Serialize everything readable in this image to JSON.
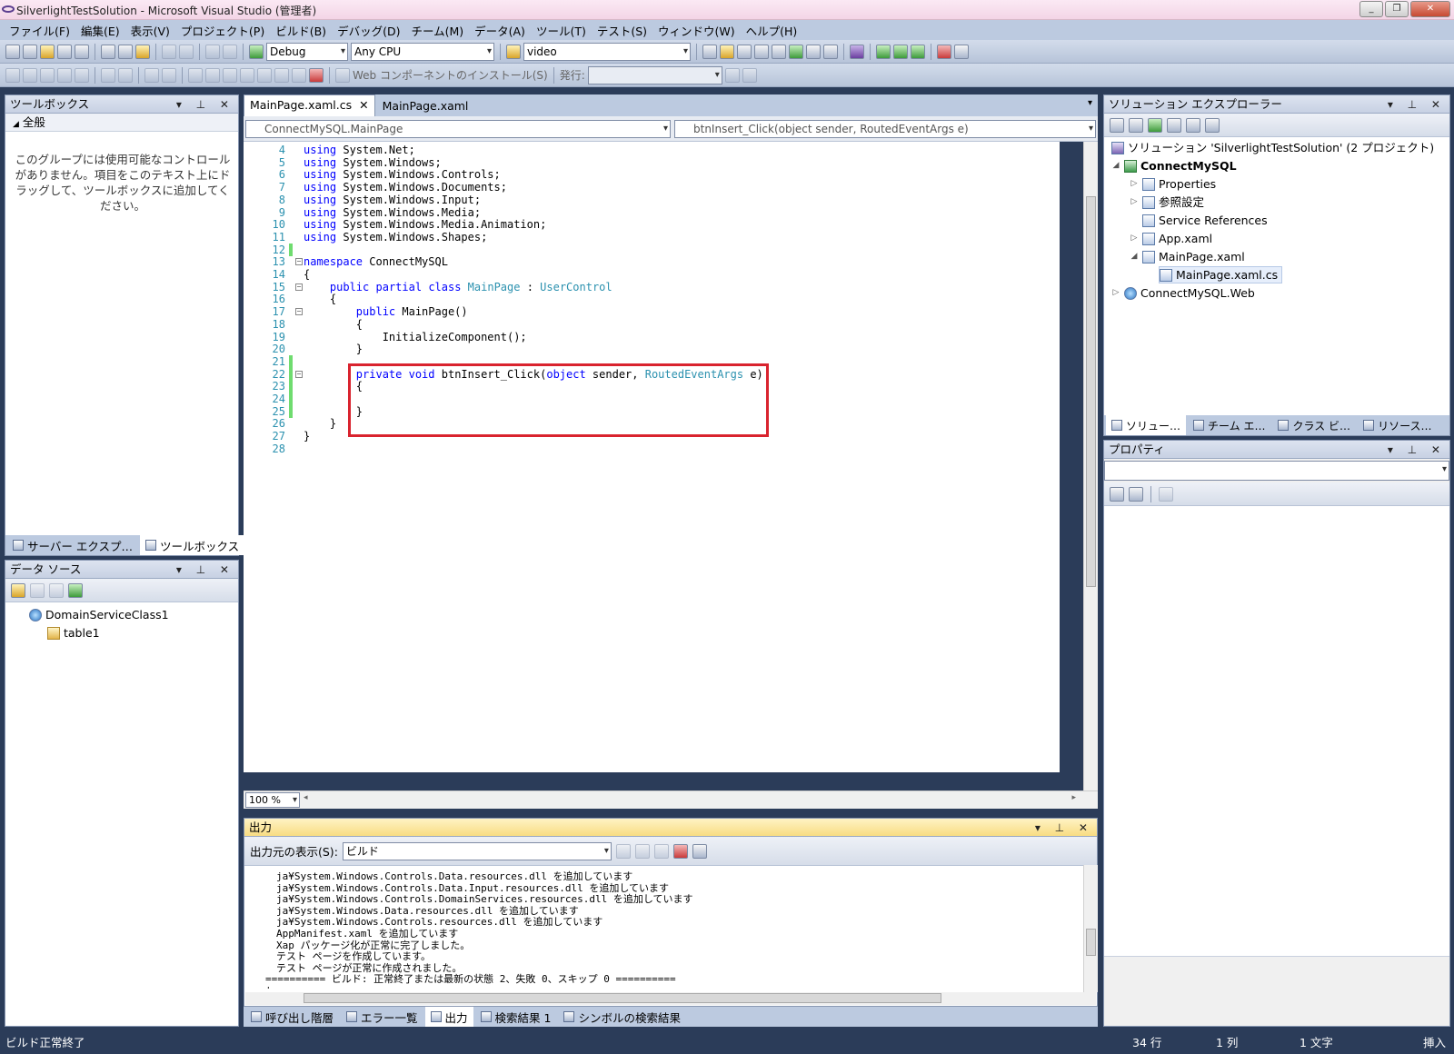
{
  "window": {
    "title": "SilverlightTestSolution - Microsoft Visual Studio (管理者)"
  },
  "menu": [
    "ファイル(F)",
    "編集(E)",
    "表示(V)",
    "プロジェクト(P)",
    "ビルド(B)",
    "デバッグ(D)",
    "チーム(M)",
    "データ(A)",
    "ツール(T)",
    "テスト(S)",
    "ウィンドウ(W)",
    "ヘルプ(H)"
  ],
  "toolbar": {
    "config": "Debug",
    "platform": "Any CPU",
    "find": "video",
    "web_install": "Web コンポーネントのインストール(S)",
    "publish_label": "発行:"
  },
  "toolbox": {
    "title": "ツールボックス",
    "group": "全般",
    "empty_message": "このグループには使用可能なコントロールがありません。項目をこのテキスト上にドラッグして、ツールボックスに追加してください。",
    "tabs": [
      "サーバー エクスプ…",
      "ツールボックス"
    ]
  },
  "datasources": {
    "title": "データ ソース",
    "items": [
      "DomainServiceClass1",
      "table1"
    ]
  },
  "editor": {
    "tabs": [
      "MainPage.xaml.cs",
      "MainPage.xaml"
    ],
    "class_nav": "ConnectMySQL.MainPage",
    "member_nav": "btnInsert_Click(object sender, RoutedEventArgs e)",
    "zoom": "100 %",
    "lines": [
      {
        "n": "4",
        "t": "using System.Net;"
      },
      {
        "n": "5",
        "t": "using System.Windows;"
      },
      {
        "n": "6",
        "t": "using System.Windows.Controls;"
      },
      {
        "n": "7",
        "t": "using System.Windows.Documents;"
      },
      {
        "n": "8",
        "t": "using System.Windows.Input;"
      },
      {
        "n": "9",
        "t": "using System.Windows.Media;"
      },
      {
        "n": "10",
        "t": "using System.Windows.Media.Animation;"
      },
      {
        "n": "11",
        "t": "using System.Windows.Shapes;"
      },
      {
        "n": "12",
        "t": ""
      },
      {
        "n": "13",
        "t": "namespace ConnectMySQL"
      },
      {
        "n": "14",
        "t": "{"
      },
      {
        "n": "15",
        "t": "    public partial class MainPage : UserControl"
      },
      {
        "n": "16",
        "t": "    {"
      },
      {
        "n": "17",
        "t": "        public MainPage()"
      },
      {
        "n": "18",
        "t": "        {"
      },
      {
        "n": "19",
        "t": "            InitializeComponent();"
      },
      {
        "n": "20",
        "t": "        }"
      },
      {
        "n": "21",
        "t": ""
      },
      {
        "n": "22",
        "t": "        private void btnInsert_Click(object sender, RoutedEventArgs e)"
      },
      {
        "n": "23",
        "t": "        {"
      },
      {
        "n": "24",
        "t": ""
      },
      {
        "n": "25",
        "t": "        }"
      },
      {
        "n": "26",
        "t": "    }"
      },
      {
        "n": "27",
        "t": "}"
      },
      {
        "n": "28",
        "t": ""
      }
    ]
  },
  "output": {
    "title": "出力",
    "show_from_label": "出力元の表示(S):",
    "source": "ビルド",
    "lines": [
      "ja¥System.Windows.Controls.Data.resources.dll を追加しています",
      "ja¥System.Windows.Controls.Data.Input.resources.dll を追加しています",
      "ja¥System.Windows.Controls.DomainServices.resources.dll を追加しています",
      "ja¥System.Windows.Data.resources.dll を追加しています",
      "ja¥System.Windows.Controls.resources.dll を追加しています",
      "AppManifest.xaml を追加しています",
      "Xap パッケージ化が正常に完了しました。",
      "テスト ページを作成しています。",
      "テスト ページが正常に作成されました。",
      "========== ビルド: 正常終了または最新の状態 2、失敗 0、スキップ 0 ==========",
      "|"
    ]
  },
  "bottom_tabs": [
    "呼び出し階層",
    "エラー一覧",
    "出力",
    "検索結果 1",
    "シンボルの検索結果"
  ],
  "solution": {
    "title": "ソリューション エクスプローラー",
    "root": "ソリューション 'SilverlightTestSolution' (2 プロジェクト)",
    "items": [
      "ConnectMySQL",
      "Properties",
      "参照設定",
      "Service References",
      "App.xaml",
      "MainPage.xaml",
      "MainPage.xaml.cs",
      "ConnectMySQL.Web"
    ],
    "tabs": [
      "ソリュー…",
      "チーム エ…",
      "クラス ビ…",
      "リソース…"
    ]
  },
  "properties": {
    "title": "プロパティ"
  },
  "status": {
    "message": "ビルド正常終了",
    "line": "34 行",
    "col": "1 列",
    "ch": "1 文字",
    "mode": "挿入"
  },
  "colors": {
    "keyword": "#0000ff",
    "type": "#2b91af",
    "highlight_box": "#d9232e",
    "frame": "#2b3c59"
  }
}
